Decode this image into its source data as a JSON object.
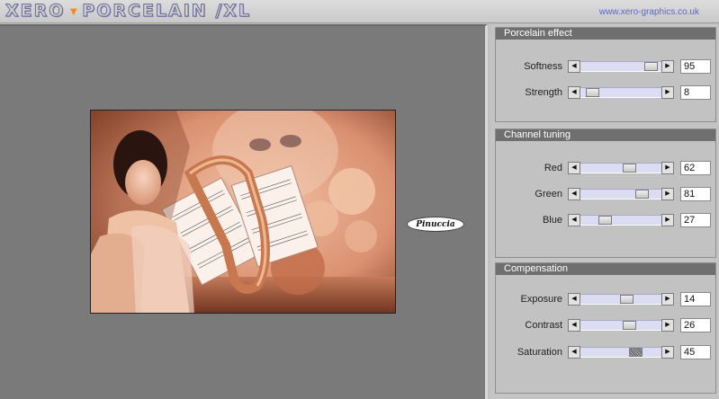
{
  "header": {
    "logo_left": "XERO",
    "logo_right": "PORCELAIN /XL",
    "url": "www.xero-graphics.co.uk"
  },
  "preview": {
    "watermark": "Pinuccia"
  },
  "panels": [
    {
      "title": "Porcelain effect",
      "rows": [
        {
          "label": "Softness",
          "value": "95",
          "level": 0.95
        },
        {
          "label": "Strength",
          "value": "8",
          "level": 0.08
        }
      ]
    },
    {
      "title": "Channel tuning",
      "rows": [
        {
          "label": "Red",
          "value": "62",
          "level": 0.62
        },
        {
          "label": "Green",
          "value": "81",
          "level": 0.81
        },
        {
          "label": "Blue",
          "value": "27",
          "level": 0.27
        }
      ]
    },
    {
      "title": "Compensation",
      "rows": [
        {
          "label": "Exposure",
          "value": "14",
          "level": 0.58
        },
        {
          "label": "Contrast",
          "value": "26",
          "level": 0.63
        },
        {
          "label": "Saturation",
          "value": "45",
          "level": 0.72
        }
      ]
    }
  ],
  "icons": {
    "left_arrow": "arrow-left-icon",
    "right_arrow": "arrow-right-icon"
  },
  "colors": {
    "panel_title_bg": "#6f6f6f",
    "preview_bg": "#7a7a7a",
    "track": "#dcdcf2",
    "accent_orange": "#f08a1e",
    "url_blue": "#5c6ac8"
  }
}
